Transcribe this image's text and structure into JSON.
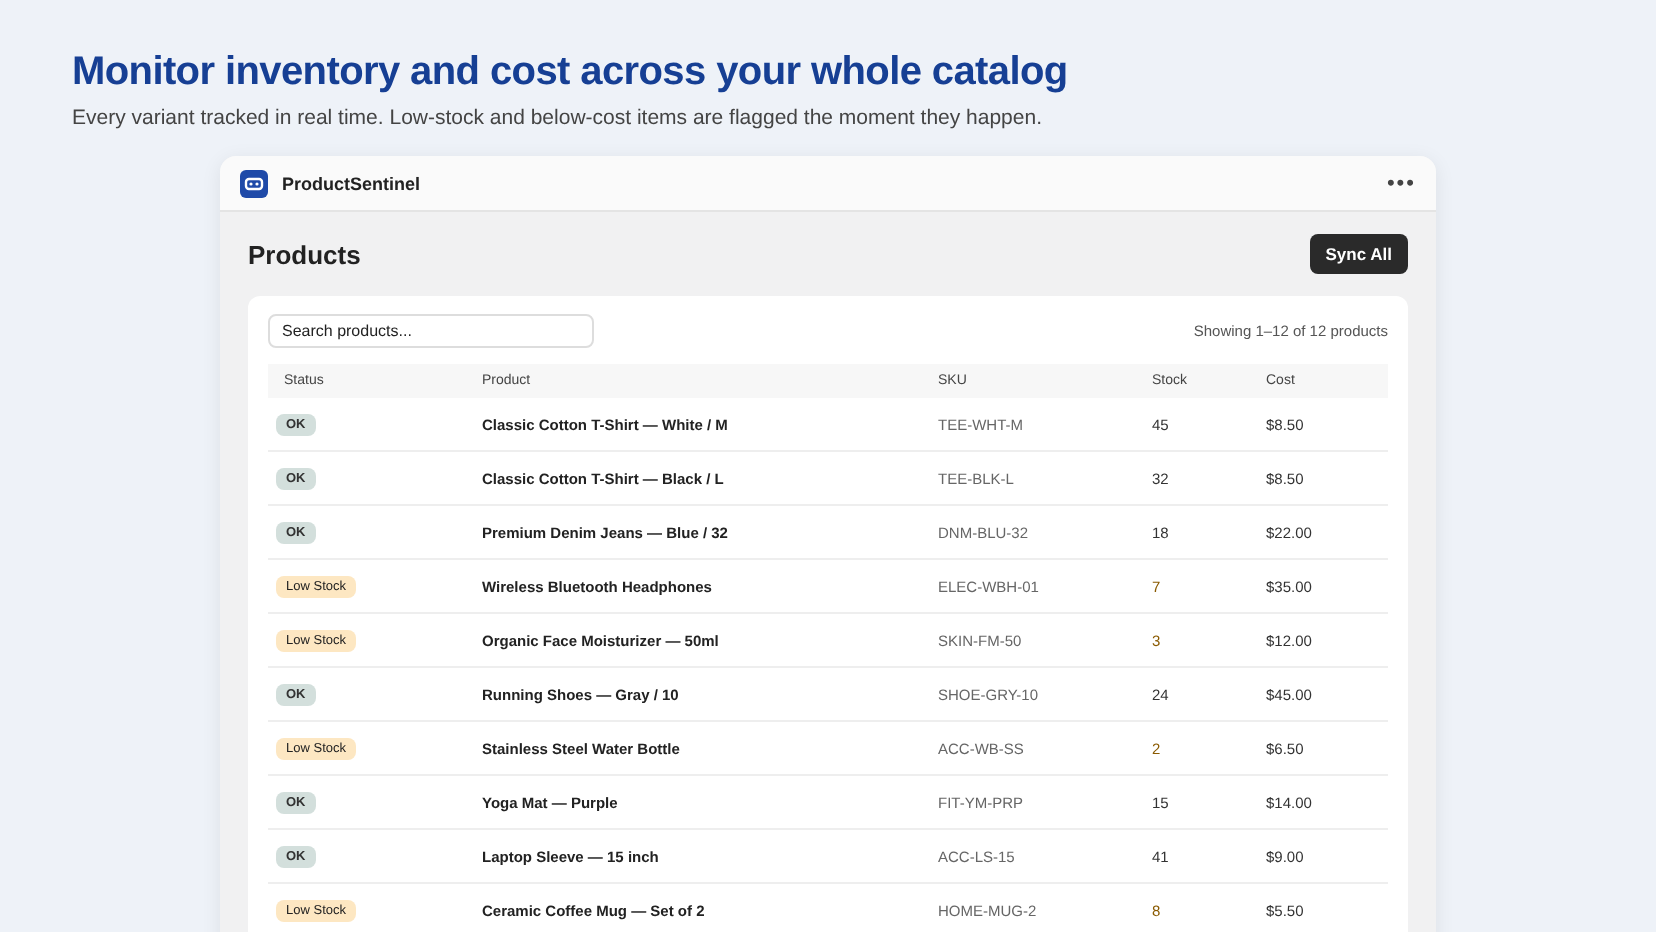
{
  "headline": "Monitor inventory and cost across your whole catalog",
  "subtitle": "Every variant tracked in real time. Low-stock and below-cost items are flagged the moment they happen.",
  "window": {
    "title": "ProductSentinel",
    "menu": "•••"
  },
  "page": {
    "title": "Products",
    "button": "Sync All"
  },
  "search": {
    "placeholder": "Search products..."
  },
  "count": "Showing 1–12 of 12 products",
  "table": {
    "columns": [
      "Status",
      "Product",
      "SKU",
      "Stock",
      "Cost"
    ],
    "rows": [
      {
        "status": "OK",
        "kind": "ok",
        "product": "Classic Cotton T-Shirt — White / M",
        "sku": "TEE-WHT-M",
        "stock": "45",
        "cost": "$8.50"
      },
      {
        "status": "OK",
        "kind": "ok",
        "product": "Classic Cotton T-Shirt — Black / L",
        "sku": "TEE-BLK-L",
        "stock": "32",
        "cost": "$8.50"
      },
      {
        "status": "OK",
        "kind": "ok",
        "product": "Premium Denim Jeans — Blue / 32",
        "sku": "DNM-BLU-32",
        "stock": "18",
        "cost": "$22.00"
      },
      {
        "status": "Low Stock",
        "kind": "low",
        "product": "Wireless Bluetooth Headphones",
        "sku": "ELEC-WBH-01",
        "stock": "7",
        "cost": "$35.00"
      },
      {
        "status": "Low Stock",
        "kind": "low",
        "product": "Organic Face Moisturizer — 50ml",
        "sku": "SKIN-FM-50",
        "stock": "3",
        "cost": "$12.00"
      },
      {
        "status": "OK",
        "kind": "ok",
        "product": "Running Shoes — Gray / 10",
        "sku": "SHOE-GRY-10",
        "stock": "24",
        "cost": "$45.00"
      },
      {
        "status": "Low Stock",
        "kind": "low",
        "product": "Stainless Steel Water Bottle",
        "sku": "ACC-WB-SS",
        "stock": "2",
        "cost": "$6.50"
      },
      {
        "status": "OK",
        "kind": "ok",
        "product": "Yoga Mat — Purple",
        "sku": "FIT-YM-PRP",
        "stock": "15",
        "cost": "$14.00"
      },
      {
        "status": "OK",
        "kind": "ok",
        "product": "Laptop Sleeve — 15 inch",
        "sku": "ACC-LS-15",
        "stock": "41",
        "cost": "$9.00"
      },
      {
        "status": "Low Stock",
        "kind": "low",
        "product": "Ceramic Coffee Mug — Set of 2",
        "sku": "HOME-MUG-2",
        "stock": "8",
        "cost": "$5.50"
      }
    ]
  }
}
